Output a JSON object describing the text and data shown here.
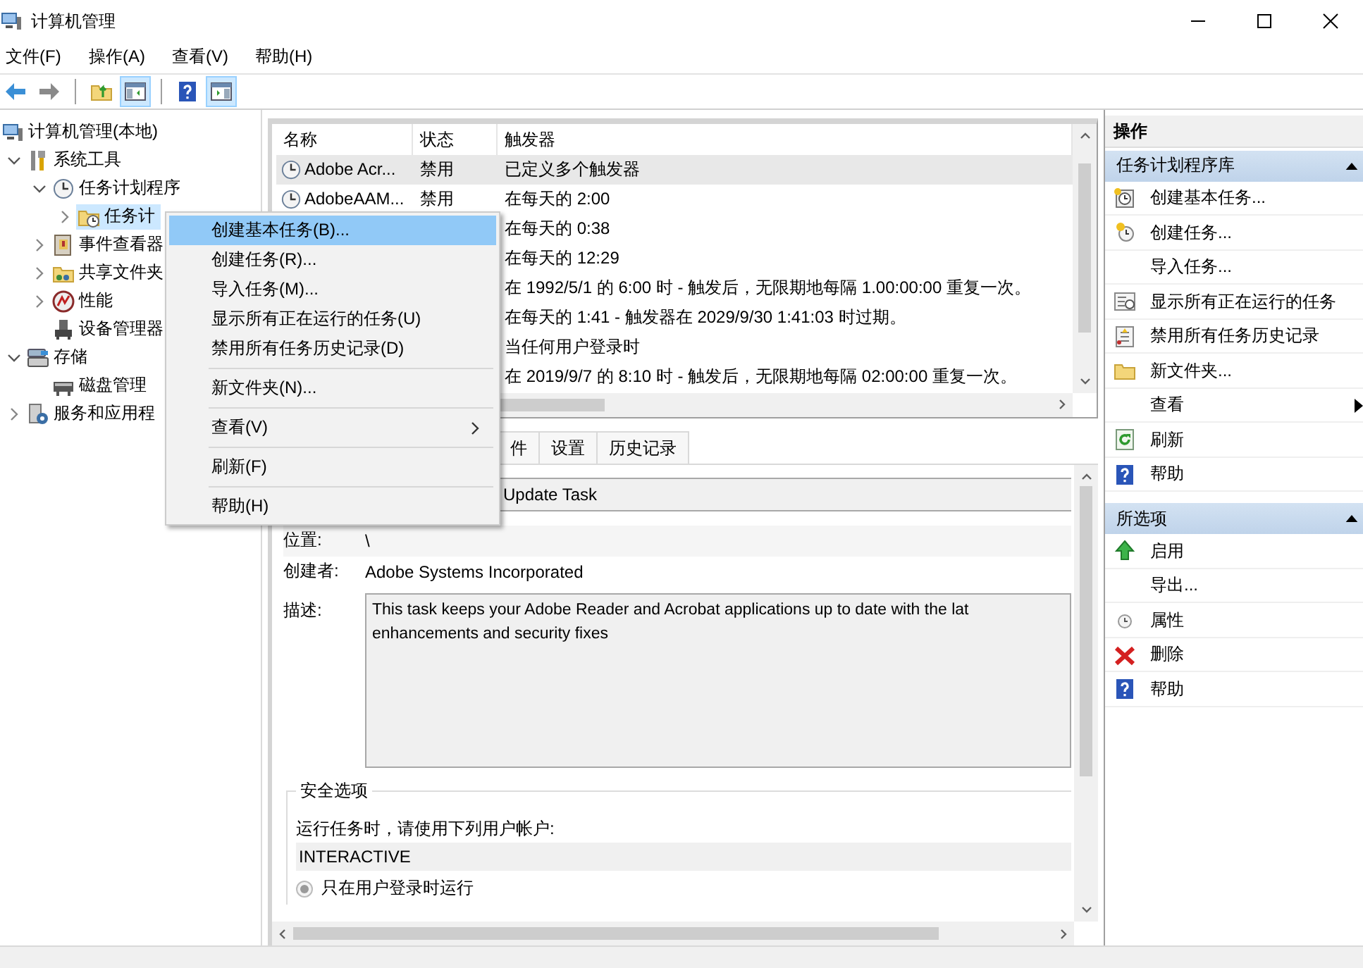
{
  "window": {
    "title": "计算机管理"
  },
  "menu_bar": [
    "文件(F)",
    "操作(A)",
    "查看(V)",
    "帮助(H)"
  ],
  "toolbar": [
    {
      "kind": "back"
    },
    {
      "kind": "forward"
    },
    {
      "kind": "separator"
    },
    {
      "kind": "up",
      "pressed": false
    },
    {
      "kind": "tree-pane",
      "pressed": true
    },
    {
      "kind": "separator"
    },
    {
      "kind": "help",
      "pressed": false
    },
    {
      "kind": "action-pane",
      "pressed": true
    }
  ],
  "tree": [
    {
      "label": "计算机管理(本地)",
      "kind": "computer",
      "selected": false,
      "children": [
        {
          "label": "系统工具",
          "kind": "tools",
          "expanded": true,
          "selected": false,
          "children": [
            {
              "label": "任务计划程序",
              "kind": "scheduler",
              "expanded": true,
              "selected": false,
              "children": [
                {
                  "label": "任务计",
                  "kind": "folder",
                  "expanded": false,
                  "selected": true
                }
              ]
            },
            {
              "label": "事件查看器",
              "kind": "events",
              "expanded": false,
              "selected": false
            },
            {
              "label": "共享文件夹",
              "kind": "share",
              "expanded": false,
              "selected": false
            },
            {
              "label": "性能",
              "kind": "performance",
              "expanded": false,
              "selected": false
            },
            {
              "label": "设备管理器",
              "kind": "devices",
              "selected": false
            }
          ]
        },
        {
          "label": "存储",
          "kind": "storage",
          "expanded": true,
          "selected": false,
          "children": [
            {
              "label": "磁盘管理",
              "kind": "disk",
              "selected": false
            }
          ]
        },
        {
          "label": "服务和应用程",
          "kind": "services",
          "expanded": false,
          "selected": false
        }
      ]
    }
  ],
  "task_table": {
    "columns": [
      "名称",
      "状态",
      "触发器"
    ],
    "rows": [
      {
        "name": "Adobe Acr...",
        "status": "禁用",
        "trigger": "已定义多个触发器",
        "selected": true
      },
      {
        "name": "AdobeAAM...",
        "status": "禁用",
        "trigger": "在每天的 2:00",
        "selected": false
      },
      {
        "trigger": "在每天的 0:38",
        "selected": false
      },
      {
        "trigger": "在每天的 12:29",
        "selected": false
      },
      {
        "trigger": "在 1992/5/1 的 6:00 时 - 触发后，无限期地每隔 1.00:00:00 重复一次。",
        "selected": false
      },
      {
        "trigger": "在每天的 1:41 - 触发器在 2029/9/30 1:41:03 时过期。",
        "selected": false
      },
      {
        "trigger": "当任何用户登录时",
        "selected": false
      },
      {
        "trigger": "在 2019/9/7 的 8:10 时 - 触发后，无限期地每隔 02:00:00 重复一次。",
        "selected": false
      }
    ]
  },
  "detail": {
    "tabs": [
      {
        "label": "件",
        "selected": false
      },
      {
        "label": "设置",
        "selected": false
      },
      {
        "label": "历史记录",
        "selected": false
      }
    ],
    "name_value": "Update Task",
    "fields": [
      {
        "label": "位置:",
        "value": "\\"
      },
      {
        "label": "创建者:",
        "value": "Adobe Systems Incorporated"
      }
    ],
    "description": {
      "label": "描述:",
      "lines": [
        "This task keeps your Adobe Reader and Acrobat applications up to date with the lat",
        "enhancements and security fixes"
      ]
    },
    "security": {
      "legend": "安全选项",
      "prompt": "运行任务时，请使用下列用户帐户:",
      "account": "INTERACTIVE",
      "options": [
        {
          "label": "只在用户登录时运行",
          "selected": true,
          "disabled": true
        }
      ]
    }
  },
  "actions": {
    "title": "操作",
    "sections": [
      {
        "title": "任务计划程序库",
        "expanded": true,
        "items": [
          {
            "label": "创建基本任务...",
            "kind": "basic-task"
          },
          {
            "label": "创建任务...",
            "kind": "task"
          },
          {
            "label": "导入任务...",
            "kind": "plain"
          },
          {
            "label": "显示所有正在运行的任务",
            "kind": "running"
          },
          {
            "label": "禁用所有任务历史记录",
            "kind": "history"
          },
          {
            "label": "新文件夹...",
            "kind": "folder"
          },
          {
            "label": "查看",
            "kind": "submenu"
          },
          {
            "label": "刷新",
            "kind": "refresh"
          },
          {
            "label": "帮助",
            "kind": "help"
          }
        ]
      },
      {
        "title": "所选项",
        "expanded": true,
        "items": [
          {
            "label": "启用",
            "kind": "enable"
          },
          {
            "label": "导出...",
            "kind": "plain"
          },
          {
            "label": "属性",
            "kind": "properties"
          },
          {
            "label": "删除",
            "kind": "delete"
          },
          {
            "label": "帮助",
            "kind": "help"
          }
        ]
      }
    ]
  },
  "context_menu": {
    "items": [
      {
        "kind": "item",
        "label": "创建基本任务(B)...",
        "selected": true
      },
      {
        "kind": "item",
        "label": "创建任务(R)...",
        "selected": false
      },
      {
        "kind": "item",
        "label": "导入任务(M)...",
        "selected": false
      },
      {
        "kind": "item",
        "label": "显示所有正在运行的任务(U)",
        "selected": false
      },
      {
        "kind": "item",
        "label": "禁用所有任务历史记录(D)",
        "selected": false
      },
      {
        "kind": "separator"
      },
      {
        "kind": "item",
        "label": "新文件夹(N)...",
        "selected": false
      },
      {
        "kind": "separator"
      },
      {
        "kind": "submenu",
        "label": "查看(V)",
        "selected": false
      },
      {
        "kind": "separator"
      },
      {
        "kind": "item",
        "label": "刷新(F)",
        "selected": false
      },
      {
        "kind": "separator"
      },
      {
        "kind": "item",
        "label": "帮助(H)",
        "selected": false
      }
    ]
  }
}
